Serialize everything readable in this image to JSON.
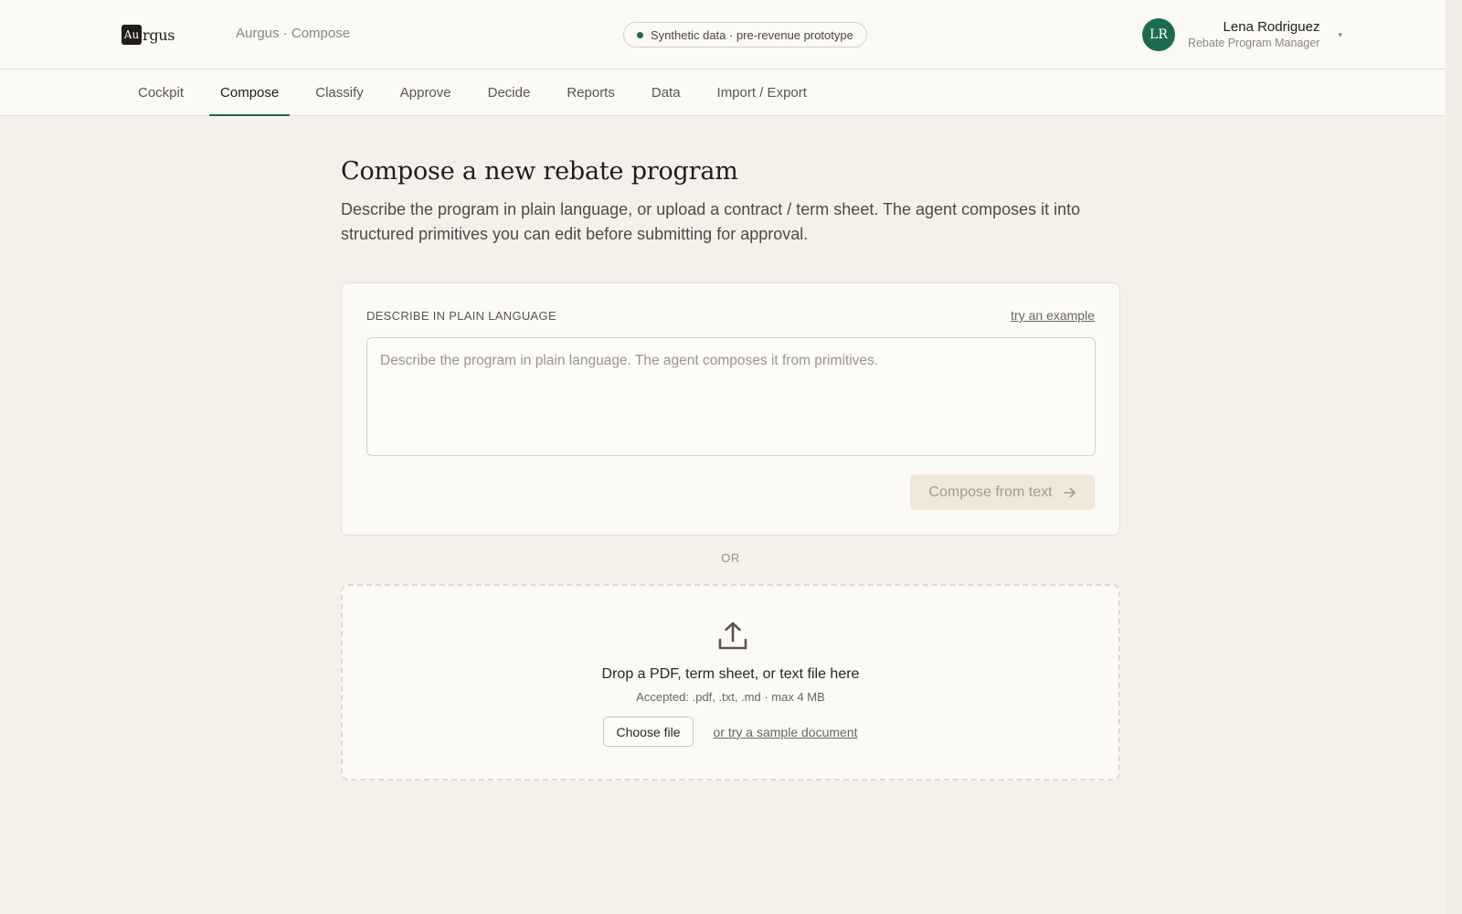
{
  "header": {
    "logo_mark": "Au",
    "logo_rest": "rgus",
    "breadcrumb": "Aurgus · Compose",
    "status_pill": "Synthetic data · pre-revenue prototype",
    "user": {
      "initials": "LR",
      "name": "Lena Rodriguez",
      "role": "Rebate Program Manager"
    }
  },
  "nav": {
    "tabs": [
      {
        "label": "Cockpit"
      },
      {
        "label": "Compose"
      },
      {
        "label": "Classify"
      },
      {
        "label": "Approve"
      },
      {
        "label": "Decide"
      },
      {
        "label": "Reports"
      },
      {
        "label": "Data"
      },
      {
        "label": "Import / Export"
      }
    ],
    "active": "Compose"
  },
  "main": {
    "title": "Compose a new rebate program",
    "description": "Describe the program in plain language, or upload a contract / term sheet. The agent composes it into structured primitives you can edit before submitting for approval."
  },
  "describe_card": {
    "label": "DESCRIBE IN PLAIN LANGUAGE",
    "example_link": "try an example",
    "textarea_value": "",
    "textarea_placeholder": "Describe the program in plain language. The agent composes it from primitives.",
    "compose_button": "Compose from text"
  },
  "divider": "OR",
  "upload": {
    "title": "Drop a PDF, term sheet, or text file here",
    "accepted": "Accepted: .pdf, .txt, .md · max 4 MB",
    "choose_button": "Choose file",
    "sample_link": "or try a sample document"
  },
  "colors": {
    "accent": "#1d6b4f",
    "background": "#f5f1ea",
    "surface": "#fbfaf6"
  }
}
